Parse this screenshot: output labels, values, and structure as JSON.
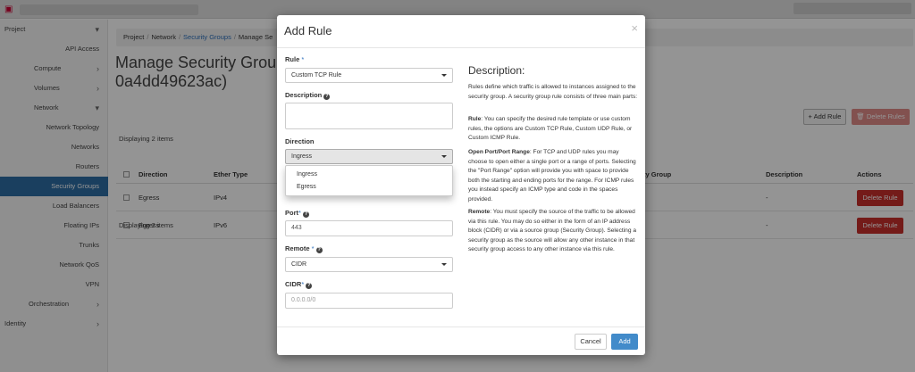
{
  "sidebar": {
    "items": [
      {
        "label": "Project",
        "chevron": "▾"
      },
      {
        "label": "API Access",
        "chevron": ""
      },
      {
        "label": "Compute",
        "chevron": "›"
      },
      {
        "label": "Volumes",
        "chevron": "›"
      },
      {
        "label": "Network",
        "chevron": "▾"
      },
      {
        "label": "Network Topology",
        "chevron": ""
      },
      {
        "label": "Networks",
        "chevron": ""
      },
      {
        "label": "Routers",
        "chevron": ""
      },
      {
        "label": "Security Groups",
        "chevron": ""
      },
      {
        "label": "Load Balancers",
        "chevron": ""
      },
      {
        "label": "Floating IPs",
        "chevron": ""
      },
      {
        "label": "Trunks",
        "chevron": ""
      },
      {
        "label": "Network QoS",
        "chevron": ""
      },
      {
        "label": "VPN",
        "chevron": ""
      },
      {
        "label": "Orchestration",
        "chevron": "›"
      },
      {
        "label": "Identity",
        "chevron": "›"
      }
    ]
  },
  "breadcrumb": {
    "project": "Project",
    "network": "Network",
    "security_groups": "Security Groups",
    "current": "Manage Se",
    "sep": "/"
  },
  "page": {
    "title_line1": "Manage Security Grou",
    "title_line2": "0a4dd49623ac)",
    "add_rule": "+ Add Rule",
    "delete_rules": "🗑 Delete Rules",
    "displaying": "Displaying 2 items"
  },
  "table": {
    "headers": {
      "direction": "Direction",
      "ether_type": "Ether Type",
      "security_group": "ty Group",
      "description": "Description",
      "actions": "Actions"
    },
    "rows": [
      {
        "direction": "Egress",
        "ether_type": "IPv4",
        "description": "-",
        "action": "Delete Rule"
      },
      {
        "direction": "Egress",
        "ether_type": "IPv6",
        "description": "-",
        "action": "Delete Rule"
      }
    ]
  },
  "modal": {
    "title": "Add Rule",
    "close": "×",
    "rule_label": "Rule",
    "required_mark": "*",
    "rule_value": "Custom TCP Rule",
    "description_label": "Description",
    "help": "?",
    "direction_label": "Direction",
    "direction_value": "Ingress",
    "direction_options": [
      "Ingress",
      "Egress"
    ],
    "port_label": "Port",
    "port_value": "443",
    "remote_label": "Remote",
    "remote_value": "CIDR",
    "cidr_label": "CIDR",
    "cidr_placeholder": "0.0.0.0/0",
    "cancel": "Cancel",
    "add": "Add"
  },
  "help_panel": {
    "title": "Description:",
    "intro": "Rules define which traffic is allowed to instances assigned to the security group. A security group rule consists of three main parts:",
    "rule_term": "Rule",
    "rule_text": ": You can specify the desired rule template or use custom rules, the options are Custom TCP Rule, Custom UDP Rule, or Custom ICMP Rule.",
    "port_term": "Open Port/Port Range",
    "port_text": ": For TCP and UDP rules you may choose to open either a single port or a range of ports. Selecting the \"Port Range\" option will provide you with space to provide both the starting and ending ports for the range. For ICMP rules you instead specify an ICMP type and code in the spaces provided.",
    "remote_term": "Remote",
    "remote_text": ": You must specify the source of the traffic to be allowed via this rule. You may do so either in the form of an IP address block (CIDR) or via a source group (Security Group). Selecting a security group as the source will allow any other instance in that security group access to any other instance via this rule."
  }
}
